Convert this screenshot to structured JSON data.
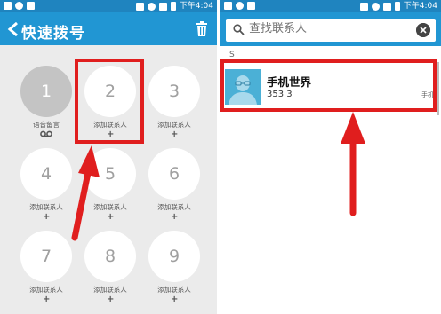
{
  "left": {
    "status": {
      "time": "下午4:04"
    },
    "title": "快速拨号",
    "cells": [
      {
        "num": "1",
        "label": "语音留言"
      },
      {
        "num": "2",
        "label": "添加联系人"
      },
      {
        "num": "3",
        "label": "添加联系人"
      },
      {
        "num": "4",
        "label": "添加联系人"
      },
      {
        "num": "5",
        "label": "添加联系人"
      },
      {
        "num": "6",
        "label": "添加联系人"
      },
      {
        "num": "7",
        "label": "添加联系人"
      },
      {
        "num": "8",
        "label": "添加联系人"
      },
      {
        "num": "9",
        "label": "添加联系人"
      }
    ],
    "plus": "+"
  },
  "right": {
    "status": {
      "time": "下午4:04"
    },
    "search": {
      "placeholder": "查找联系人"
    },
    "section": "S",
    "contact": {
      "name": "手机世界",
      "number": "353 3",
      "type": "手机"
    }
  },
  "colors": {
    "statusbar": "#1f84bf",
    "appbar": "#2196d3",
    "highlight": "#e01e1e",
    "avatar": "#4bb0d6"
  },
  "icons": [
    "back-icon",
    "trash-icon",
    "voicemail-icon",
    "plus-icon",
    "search-icon",
    "clear-icon",
    "avatar-icon"
  ]
}
